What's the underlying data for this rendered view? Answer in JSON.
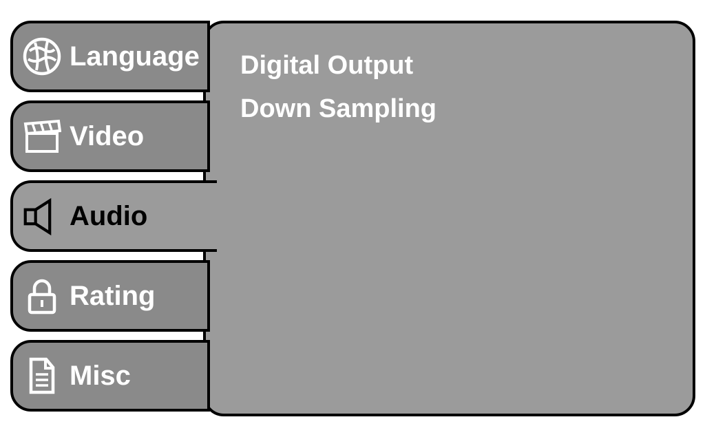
{
  "tabs": {
    "language": {
      "label": "Language"
    },
    "video": {
      "label": "Video"
    },
    "audio": {
      "label": "Audio"
    },
    "rating": {
      "label": "Rating"
    },
    "misc": {
      "label": "Misc"
    }
  },
  "panel": {
    "items": [
      {
        "label": "Digital Output"
      },
      {
        "label": "Down Sampling"
      }
    ]
  }
}
